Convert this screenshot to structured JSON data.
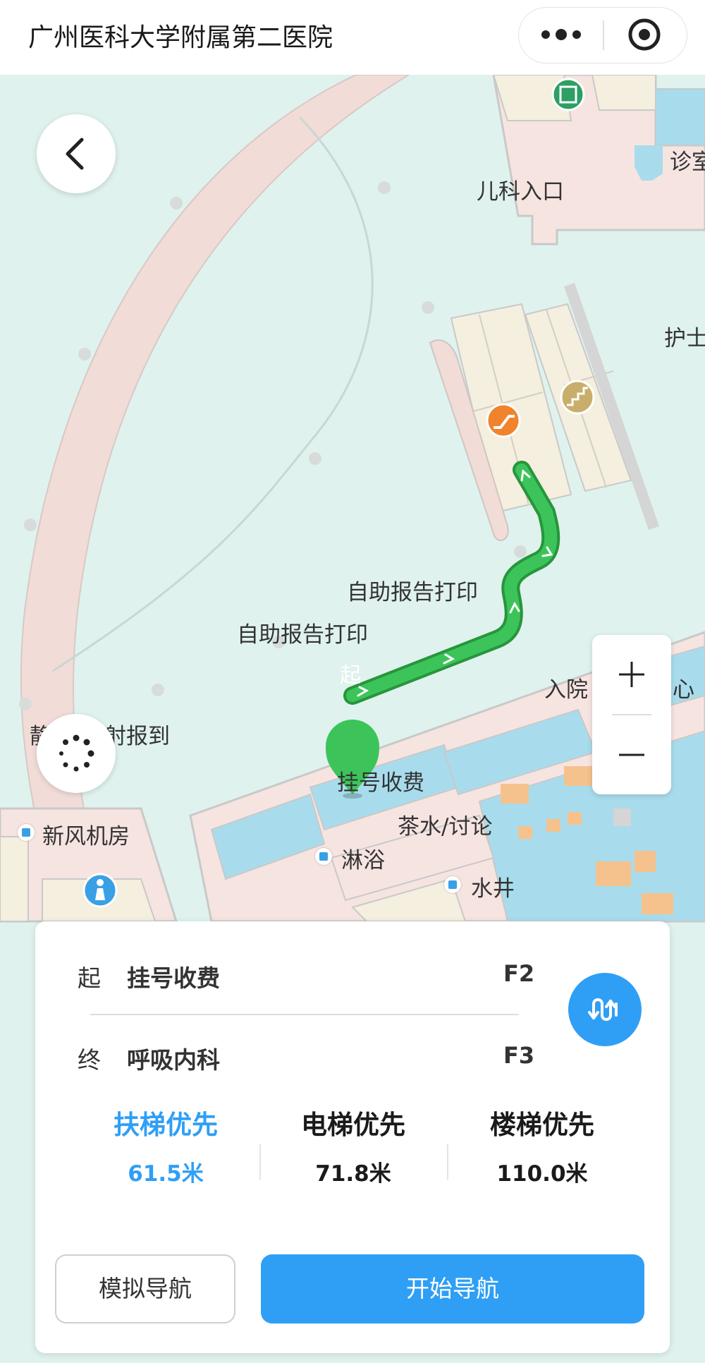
{
  "header": {
    "title": "广州医科大学附属第二医院",
    "more_icon": "more-dots-icon",
    "close_icon": "target-circle-icon"
  },
  "map": {
    "labels": {
      "pediatrics_entrance": "儿科入口",
      "clinic": "诊室",
      "nurse": "护士",
      "self_print_1": "自助报告打印",
      "self_print_2": "自助报告打印",
      "admission": "入院",
      "admission_tail": "心",
      "radiology": "静",
      "radiology_tail": "射报到",
      "registration": "挂号收费",
      "tea_room": "茶水/讨论",
      "fresh_air": "新风机房",
      "shower": "淋浴",
      "water_well": "水井"
    },
    "start_marker": "起",
    "zoom_in": "+",
    "zoom_out": "−",
    "colors": {
      "route": "#2fb34a",
      "water": "#a8dcec",
      "building": "#f4efde",
      "road": "#f1d9d6"
    }
  },
  "panel": {
    "start_tag": "起",
    "start_name": "挂号收费",
    "start_floor": "F2",
    "end_tag": "终",
    "end_name": "呼吸内科",
    "end_floor": "F3",
    "swap_icon": "swap-route-icon",
    "options": [
      {
        "name": "扶梯优先",
        "distance": "61.5米",
        "active": true
      },
      {
        "name": "电梯优先",
        "distance": "71.8米",
        "active": false
      },
      {
        "name": "楼梯优先",
        "distance": "110.0米",
        "active": false
      }
    ],
    "simulate_label": "模拟导航",
    "start_label": "开始导航",
    "accent": "#2f9ff5"
  }
}
